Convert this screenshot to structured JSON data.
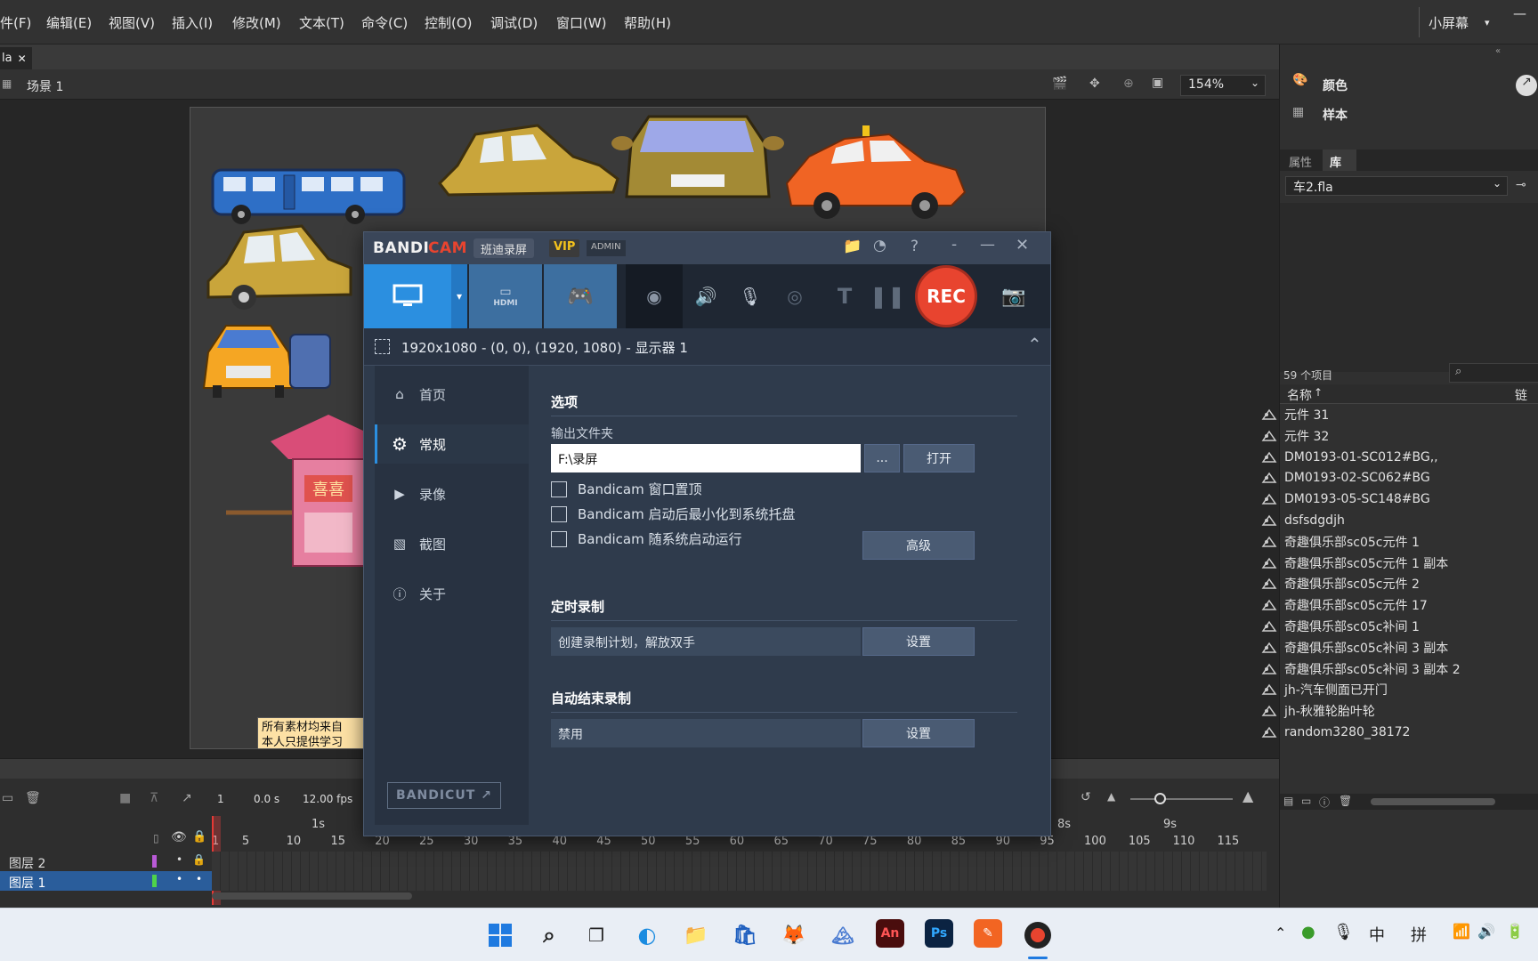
{
  "menu": [
    "件(F)",
    "编辑(E)",
    "视图(V)",
    "插入(I)",
    "修改(M)",
    "文本(T)",
    "命令(C)",
    "控制(O)",
    "调试(D)",
    "窗口(W)",
    "帮助(H)"
  ],
  "workspace": "小屏幕",
  "doc_tab": "la",
  "scene": "场景 1",
  "zoom": "154%",
  "stage_caption": [
    "所有素材均来自",
    "本人只提供学习"
  ],
  "stage_sign": "喜喜",
  "right_panel": {
    "color_label": "颜色",
    "swatch_label": "样本",
    "tab_props": "属性",
    "tab_lib": "库",
    "doc_select": "车2.fla",
    "count": "59 个项目",
    "col_name": "名称",
    "col_link": "链接",
    "items": [
      "元件 31",
      "元件 32",
      "DM0193-01-SC012#BG,,",
      "DM0193-02-SC062#BG",
      "DM0193-05-SC148#BG",
      "dsfsdgdjh",
      "奇趣俱乐部sc05c元件 1",
      "奇趣俱乐部sc05c元件 1 副本",
      "奇趣俱乐部sc05c元件 2",
      "奇趣俱乐部sc05c元件 17",
      "奇趣俱乐部sc05c补间 1",
      "奇趣俱乐部sc05c补间 3 副本",
      "奇趣俱乐部sc05c补间 3 副本 2",
      "jh-汽车侧面已开门",
      "jh-秋雅轮胎叶轮",
      "random3280_38172"
    ]
  },
  "timeline": {
    "frame": "1",
    "time": "0.0 s",
    "fps": "12.00 fps",
    "seconds": [
      "1s",
      "8s",
      "9s"
    ],
    "ticks": [
      "1",
      "5",
      "10",
      "15",
      "20",
      "25",
      "30",
      "35",
      "40",
      "45",
      "50",
      "55",
      "60",
      "65",
      "70",
      "75",
      "80",
      "85",
      "90",
      "95",
      "100",
      "105",
      "110",
      "115"
    ],
    "layers": [
      "图层 2",
      "图层 1"
    ]
  },
  "bandicam": {
    "logo_a": "BANDI",
    "logo_b": "CAM",
    "badge_cn": "班迪录屏",
    "badge_vip": "VIP",
    "badge_admin": "ADMIN",
    "rec": "REC",
    "hdmi": "HDMI",
    "resolution": "1920x1080 - (0, 0), (1920, 1080) - 显示器 1",
    "nav": [
      "首页",
      "常规",
      "录像",
      "截图",
      "关于"
    ],
    "active_nav": "常规",
    "bandicut": "BANDICUT",
    "options_title": "选项",
    "output_label": "输出文件夹",
    "output_path": "F:\\录屏",
    "browse": "...",
    "open": "打开",
    "checks": [
      "Bandicam 窗口置顶",
      "Bandicam 启动后最小化到系统托盘",
      "Bandicam 随系统启动运行"
    ],
    "advanced": "高级",
    "timer_title": "定时录制",
    "timer_value": "创建录制计划，解放双手",
    "timer_btn": "设置",
    "autostop_title": "自动结束录制",
    "autostop_value": "禁用",
    "autostop_btn": "设置"
  },
  "tray": {
    "ime1": "中",
    "ime2": "拼"
  },
  "colors": {
    "accent_blue": "#2b8fe0",
    "rec_red": "#e8442f",
    "bandi_bg": "#2f3b4c"
  }
}
